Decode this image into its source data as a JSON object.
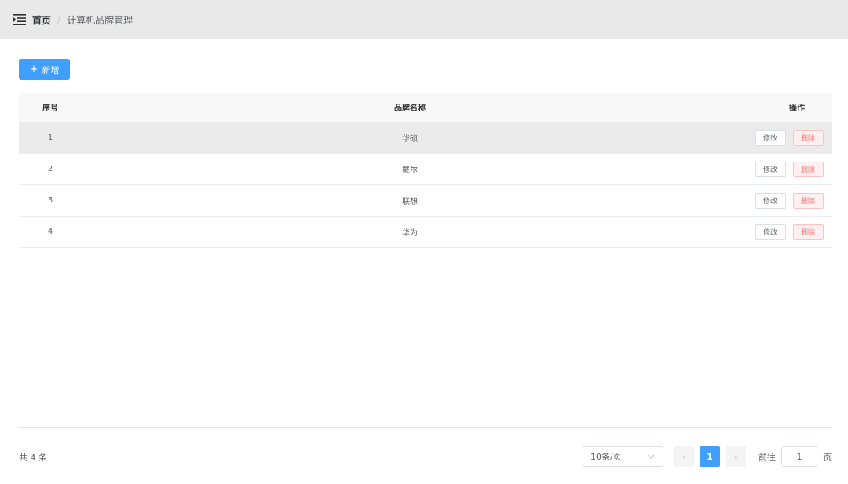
{
  "breadcrumb": {
    "home": "首页",
    "separator": "/",
    "current": "计算机品牌管理"
  },
  "toolbar": {
    "add_label": "新增",
    "add_icon": "plus-icon"
  },
  "table": {
    "headers": {
      "index": "序号",
      "name": "品牌名称",
      "ops": "操作"
    },
    "rows": [
      {
        "index": "1",
        "name": "华硕",
        "edit": "修改",
        "delete": "删除"
      },
      {
        "index": "2",
        "name": "戴尔",
        "edit": "修改",
        "delete": "删除"
      },
      {
        "index": "3",
        "name": "联想",
        "edit": "修改",
        "delete": "删除"
      },
      {
        "index": "4",
        "name": "华为",
        "edit": "修改",
        "delete": "删除"
      }
    ]
  },
  "pagination": {
    "total_text": "共 4 条",
    "page_size": "10条/页",
    "current_page": "1",
    "goto_label": "前往",
    "goto_value": "1",
    "goto_suffix": "页",
    "prev_symbol": "‹",
    "next_symbol": "›"
  },
  "colors": {
    "primary": "#409eff",
    "danger": "#f56c6c",
    "topbar_bg": "#e9e9e9"
  }
}
